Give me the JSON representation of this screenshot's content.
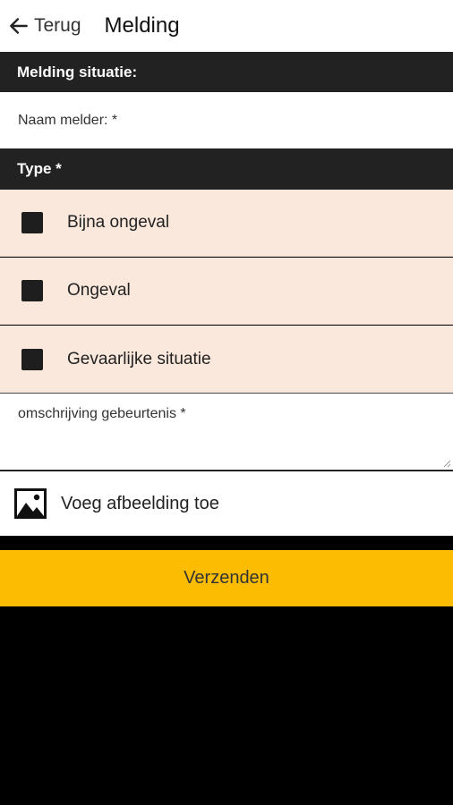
{
  "header": {
    "back_label": "Terug",
    "title": "Melding"
  },
  "section_situation": {
    "title": "Melding situatie:"
  },
  "form": {
    "name_placeholder": "Naam melder: *",
    "type_header": "Type *",
    "type_options": [
      {
        "label": "Bijna ongeval",
        "checked": false
      },
      {
        "label": "Ongeval",
        "checked": false
      },
      {
        "label": "Gevaarlijke situatie",
        "checked": false
      }
    ],
    "description_placeholder": "omschrijving gebeurtenis *",
    "add_image_label": "Voeg afbeelding toe",
    "submit_label": "Verzenden"
  },
  "colors": {
    "section_header_bg": "#222222",
    "option_bg": "#fbe8dc",
    "submit_bg": "#fcbc01",
    "screen_bg": "#000000"
  },
  "icons": {
    "back": "arrow-left-icon",
    "add_image": "image-icon",
    "checkbox": "checkbox-unchecked-icon"
  }
}
